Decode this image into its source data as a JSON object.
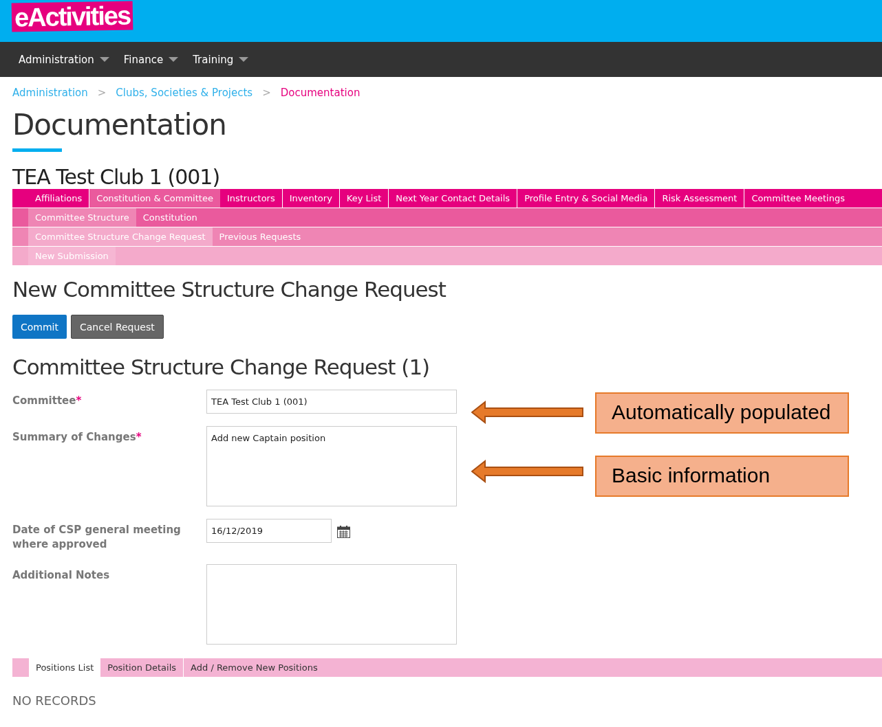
{
  "logo": "eActivities",
  "nav": [
    {
      "label": "Administration"
    },
    {
      "label": "Finance"
    },
    {
      "label": "Training"
    }
  ],
  "breadcrumb": [
    {
      "label": "Administration",
      "current": false
    },
    {
      "separator": ">",
      "label": "Clubs, Societies & Projects",
      "current": false
    },
    {
      "separator": ">",
      "label": "Documentation",
      "current": true
    }
  ],
  "page_title": "Documentation",
  "club_title": "TEA Test Club 1 (001)",
  "tab_rows": [
    [
      {
        "label": "Affiliations",
        "selected": false
      },
      {
        "label": "Constitution & Committee",
        "selected": true
      },
      {
        "label": "Instructors",
        "selected": false
      },
      {
        "label": "Inventory",
        "selected": false
      },
      {
        "label": "Key List",
        "selected": false
      },
      {
        "label": "Next Year Contact Details",
        "selected": false
      },
      {
        "label": "Profile Entry & Social Media",
        "selected": false
      },
      {
        "label": "Risk Assessment",
        "selected": false
      },
      {
        "label": "Committee Meetings",
        "selected": false
      }
    ],
    [
      {
        "label": "Committee Structure",
        "selected": true
      },
      {
        "label": "Constitution",
        "selected": false
      }
    ],
    [
      {
        "label": "Committee Structure Change Request",
        "selected": true
      },
      {
        "label": "Previous Requests",
        "selected": false
      }
    ],
    [
      {
        "label": "New Submission",
        "selected": true
      }
    ]
  ],
  "section_title": "New Committee Structure Change Request",
  "buttons": [
    {
      "label": "Commit",
      "kind": "primary"
    },
    {
      "label": "Cancel Request",
      "kind": "secondary"
    }
  ],
  "form_title": "Committee Structure Change Request (1)",
  "fields": [
    {
      "label": "Committee",
      "required_mark": "*",
      "kind": "text",
      "value": "TEA Test Club 1 (001)"
    },
    {
      "label": "Summary of Changes",
      "required_mark": "*",
      "kind": "textarea",
      "value": "Add new Captain position"
    },
    {
      "label": "Date of CSP general meeting where approved",
      "kind": "date",
      "value": "16/12/2019"
    },
    {
      "label": "Additional Notes",
      "kind": "textarea"
    }
  ],
  "callouts": [
    {
      "text": "Automatically populated"
    },
    {
      "text": "Basic information"
    }
  ],
  "bottom_tabs": [
    {
      "label": "Positions List",
      "selected": true
    },
    {
      "label": "Position Details",
      "selected": false
    },
    {
      "label": "Add / Remove New Positions",
      "selected": false
    }
  ],
  "empty_message": "NO RECORDS"
}
